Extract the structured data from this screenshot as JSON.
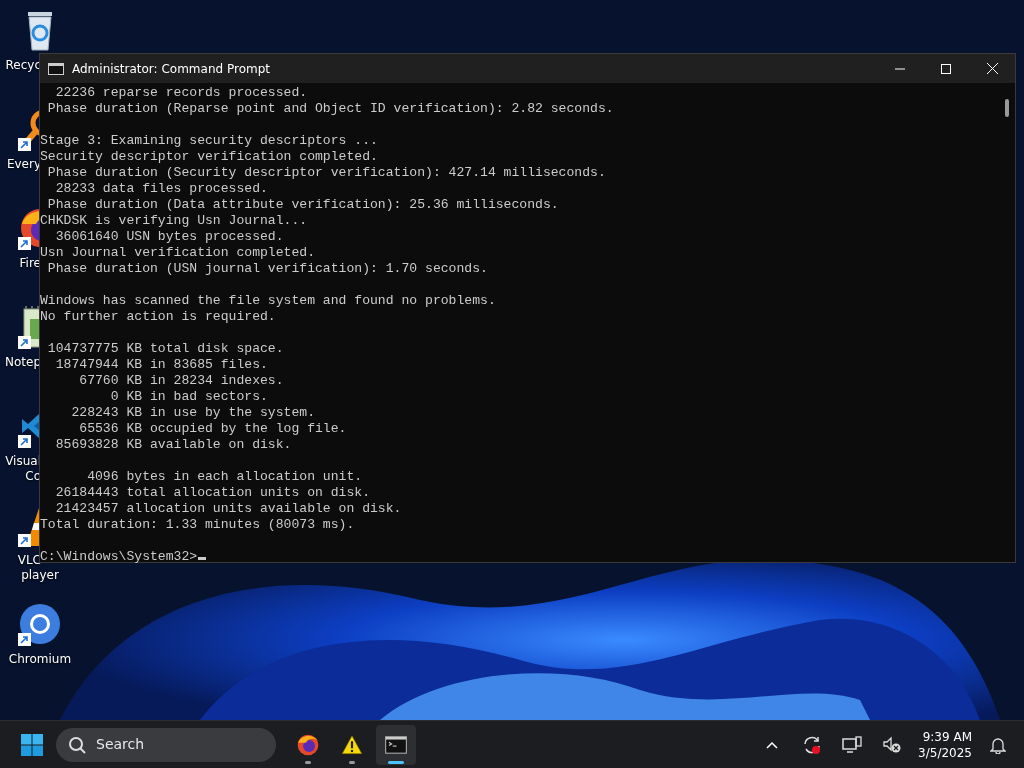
{
  "desktop_icons": [
    {
      "kind": "recycle-bin",
      "shortcut": false,
      "labels": [
        {
          "text": "Recyc",
          "cut": true
        }
      ]
    },
    {
      "kind": "search-app",
      "shortcut": true,
      "labels": [
        {
          "text": "Every",
          "cut": true
        }
      ]
    },
    {
      "kind": "browser-fox",
      "shortcut": true,
      "labels": [
        {
          "text": "Fire",
          "cut": true
        }
      ]
    },
    {
      "kind": "notepad",
      "shortcut": true,
      "labels": [
        {
          "text": "Notep",
          "cut": true
        }
      ]
    },
    {
      "kind": "code-editor",
      "shortcut": true,
      "labels": [
        {
          "text": "Visual",
          "cut": true
        },
        {
          "text": "Co",
          "cut": true
        }
      ]
    },
    {
      "kind": "cone",
      "shortcut": true,
      "labels": [
        {
          "text": "VLC",
          "cut": true
        },
        {
          "text": "player",
          "cut": false
        }
      ]
    },
    {
      "kind": "browser-ring",
      "shortcut": true,
      "labels": [
        {
          "text": "Chromium",
          "cut": false
        }
      ]
    }
  ],
  "window": {
    "title": "Administrator: Command Prompt",
    "output_blocks": [
      [
        "  22236 reparse records processed.",
        " Phase duration (Reparse point and Object ID verification): 2.82 seconds."
      ],
      [
        "Stage 3: Examining security descriptors ...",
        "Security descriptor verification completed.",
        " Phase duration (Security descriptor verification): 427.14 milliseconds.",
        "  28233 data files processed.",
        " Phase duration (Data attribute verification): 25.36 milliseconds.",
        "CHKDSK is verifying Usn Journal...",
        "  36061640 USN bytes processed.",
        "Usn Journal verification completed.",
        " Phase duration (USN journal verification): 1.70 seconds."
      ],
      [
        "Windows has scanned the file system and found no problems.",
        "No further action is required."
      ],
      [
        " 104737775 KB total disk space.",
        "  18747944 KB in 83685 files.",
        "     67760 KB in 28234 indexes.",
        "         0 KB in bad sectors.",
        "    228243 KB in use by the system.",
        "     65536 KB occupied by the log file.",
        "  85693828 KB available on disk."
      ],
      [
        "      4096 bytes in each allocation unit.",
        "  26184443 total allocation units on disk.",
        "  21423457 allocation units available on disk.",
        "Total duration: 1.33 minutes (80073 ms)."
      ]
    ],
    "prompt": "C:\\Windows\\System32>"
  },
  "taskbar": {
    "search": "Search",
    "apps": [
      {
        "kind": "browser-fox",
        "selected": false
      },
      {
        "kind": "warning",
        "selected": false
      },
      {
        "kind": "terminal",
        "selected": true
      }
    ],
    "time": "9:39 AM",
    "date": "3/5/2025"
  }
}
